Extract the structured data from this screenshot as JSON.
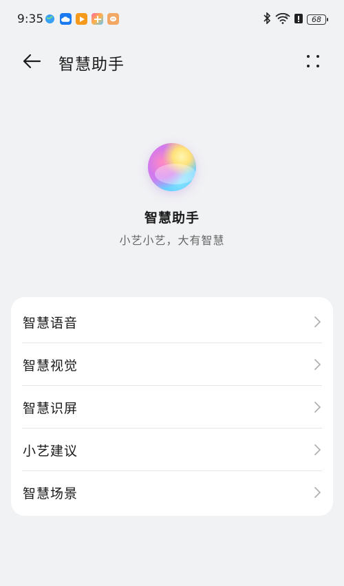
{
  "status_bar": {
    "time": "9:35",
    "battery": "68",
    "notif_icons": [
      "browser-icon",
      "cloud-icon",
      "video-icon",
      "app-store-icon",
      "message-icon"
    ],
    "system_icons": [
      "bluetooth-icon",
      "wifi-icon",
      "alert-icon",
      "battery-icon"
    ]
  },
  "header": {
    "title": "智慧助手",
    "back_icon": "back-arrow-icon",
    "more_icon": "more-dots-icon"
  },
  "hero": {
    "title": "智慧助手",
    "subtitle": "小艺小艺，大有智慧"
  },
  "menu": {
    "items": [
      {
        "label": "智慧语音"
      },
      {
        "label": "智慧视觉"
      },
      {
        "label": "智慧识屏"
      },
      {
        "label": "小艺建议"
      },
      {
        "label": "智慧场景"
      }
    ]
  },
  "colors": {
    "background": "#f1f2f4",
    "card": "#ffffff",
    "text_primary": "#1a1a1a",
    "text_secondary": "#666666",
    "chevron": "#b0b0b0"
  }
}
